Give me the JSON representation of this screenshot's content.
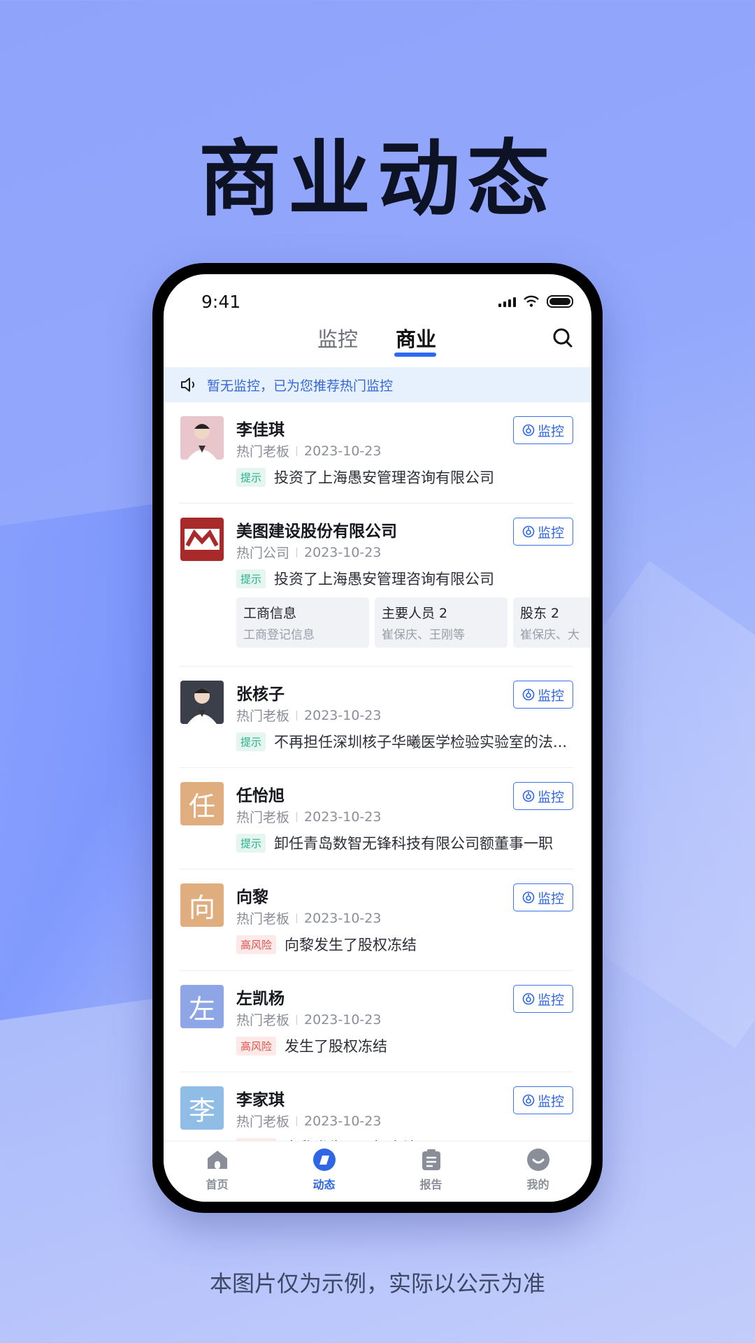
{
  "headline": "商业动态",
  "footnote": "本图片仅为示例，实际以公示为准",
  "status_bar": {
    "time": "9:41"
  },
  "header": {
    "tabs": [
      {
        "label": "监控"
      },
      {
        "label": "商业"
      }
    ],
    "active_tab": "商业"
  },
  "notice": {
    "text": "暂无监控，已为您推荐热门监控"
  },
  "watch_label": "监控",
  "items": [
    {
      "name": "李佳琪",
      "category": "热门老板",
      "date": "2023-10-23",
      "tag": "提示",
      "tag_type": "tip",
      "text": "投资了上海愚安管理咨询有限公司",
      "avatar_type": "photo-person",
      "avatar_color": "#e8c6cc"
    },
    {
      "name": "美图建设股份有限公司",
      "category": "热门公司",
      "date": "2023-10-23",
      "tag": "提示",
      "tag_type": "tip",
      "text": "投资了上海愚安管理咨询有限公司",
      "avatar_type": "logo",
      "avatar_color": "#a82a2a",
      "cards": [
        {
          "title": "工商信息",
          "sub": "工商登记信息"
        },
        {
          "title": "主要人员 2",
          "sub": "崔保庆、王刚等"
        },
        {
          "title": "股东 2",
          "sub": "崔保庆、大"
        }
      ]
    },
    {
      "name": "张核子",
      "category": "热门老板",
      "date": "2023-10-23",
      "tag": "提示",
      "tag_type": "tip",
      "text": "不再担任深圳核子华曦医学检验实验室的法...",
      "avatar_type": "photo-person",
      "avatar_color": "#3a3f4a"
    },
    {
      "name": "任怡旭",
      "category": "热门老板",
      "date": "2023-10-23",
      "tag": "提示",
      "tag_type": "tip",
      "text": "卸任青岛数智无锋科技有限公司额董事一职",
      "avatar_type": "letter",
      "avatar_letter": "任",
      "avatar_color": "#e0ae7e"
    },
    {
      "name": "向黎",
      "category": "热门老板",
      "date": "2023-10-23",
      "tag": "高风险",
      "tag_type": "risk",
      "text": "向黎发生了股权冻结",
      "avatar_type": "letter",
      "avatar_letter": "向",
      "avatar_color": "#e0ae7e"
    },
    {
      "name": "左凯杨",
      "category": "热门老板",
      "date": "2023-10-23",
      "tag": "高风险",
      "tag_type": "risk",
      "text": "发生了股权冻结",
      "avatar_type": "letter",
      "avatar_letter": "左",
      "avatar_color": "#8fa6e6"
    },
    {
      "name": "李家琪",
      "category": "热门老板",
      "date": "2023-10-23",
      "tag": "高风险",
      "tag_type": "risk",
      "text": "向黎发生了股权冻结",
      "avatar_type": "letter",
      "avatar_letter": "李",
      "avatar_color": "#8fbde6"
    }
  ],
  "bottom_nav": [
    {
      "label": "首页",
      "icon": "home-icon",
      "active": false
    },
    {
      "label": "动态",
      "icon": "dynamic-icon",
      "active": true
    },
    {
      "label": "报告",
      "icon": "report-icon",
      "active": false
    },
    {
      "label": "我的",
      "icon": "profile-icon",
      "active": false
    }
  ],
  "colors": {
    "accent": "#2e66e6",
    "tip": "#29b08a",
    "risk": "#e0524c",
    "notice_bg": "#e7f1fd"
  }
}
